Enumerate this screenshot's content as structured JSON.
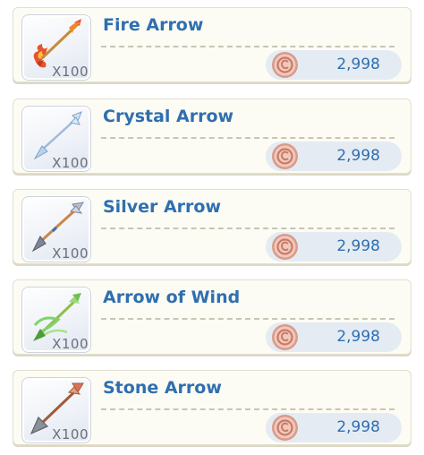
{
  "items": [
    {
      "name": "Fire Arrow",
      "quantity": "X100",
      "price": "2,998",
      "icon": "fire-arrow-icon"
    },
    {
      "name": "Crystal Arrow",
      "quantity": "X100",
      "price": "2,998",
      "icon": "crystal-arrow-icon"
    },
    {
      "name": "Silver Arrow",
      "quantity": "X100",
      "price": "2,998",
      "icon": "silver-arrow-icon"
    },
    {
      "name": "Arrow of Wind",
      "quantity": "X100",
      "price": "2,998",
      "icon": "wind-arrow-icon"
    },
    {
      "name": "Stone Arrow",
      "quantity": "X100",
      "price": "2,998",
      "icon": "stone-arrow-icon"
    }
  ],
  "currency_icon": "copper-coin-icon",
  "colors": {
    "title": "#2f6fb0",
    "price_pill": "#e4ebf3",
    "coin": "#e9b8a8"
  }
}
